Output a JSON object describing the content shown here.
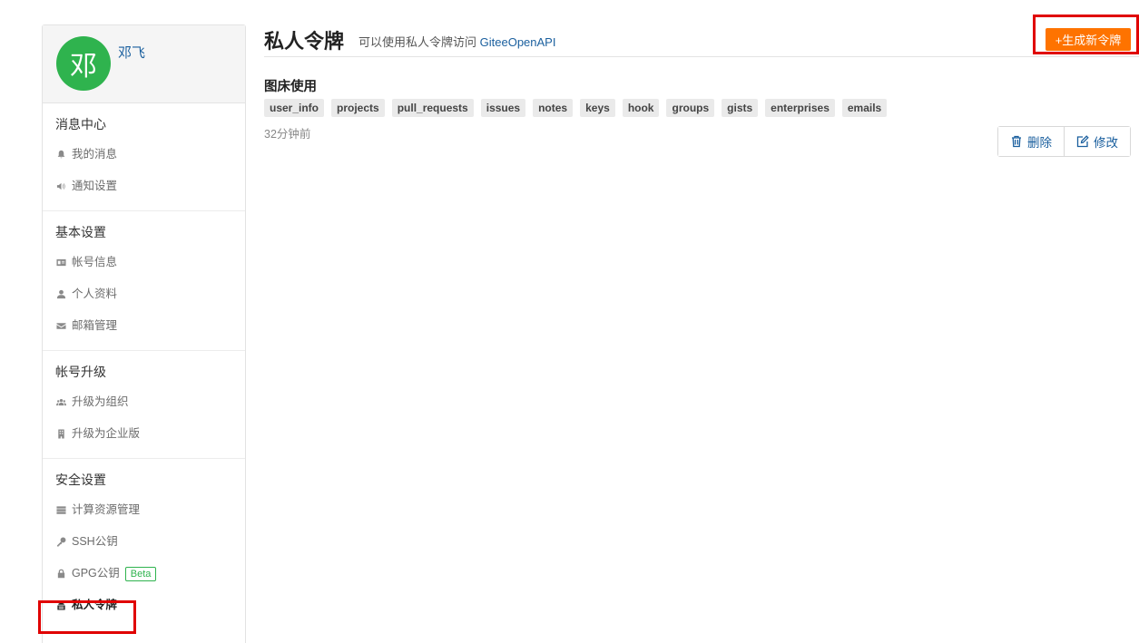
{
  "profile": {
    "avatar_text": "邓",
    "name": "邓飞",
    "avatar_color": "#2fb34e"
  },
  "sidebar": {
    "sections": [
      {
        "title": "消息中心",
        "items": [
          {
            "label": "我的消息",
            "icon": "bell-icon"
          },
          {
            "label": "通知设置",
            "icon": "speaker-icon"
          }
        ]
      },
      {
        "title": "基本设置",
        "items": [
          {
            "label": "帐号信息",
            "icon": "id-card-icon"
          },
          {
            "label": "个人资料",
            "icon": "user-icon"
          },
          {
            "label": "邮箱管理",
            "icon": "envelope-icon"
          }
        ]
      },
      {
        "title": "帐号升级",
        "items": [
          {
            "label": "升级为组织",
            "icon": "users-icon"
          },
          {
            "label": "升级为企业版",
            "icon": "building-icon"
          }
        ]
      },
      {
        "title": "安全设置",
        "items": [
          {
            "label": "计算资源管理",
            "icon": "server-icon"
          },
          {
            "label": "SSH公钥",
            "icon": "key-icon"
          },
          {
            "label": "GPG公钥",
            "icon": "lock-icon",
            "badge": "Beta"
          },
          {
            "label": "私人令牌",
            "icon": "token-icon",
            "active": true
          }
        ]
      }
    ]
  },
  "header": {
    "title": "私人令牌",
    "subtitle_prefix": "可以使用私人令牌访问",
    "subtitle_link": "GiteeOpenAPI",
    "new_button": "+生成新令牌"
  },
  "token": {
    "name": "图床使用",
    "scopes": [
      "user_info",
      "projects",
      "pull_requests",
      "issues",
      "notes",
      "keys",
      "hook",
      "groups",
      "gists",
      "enterprises",
      "emails"
    ],
    "time": "32分钟前",
    "delete_label": "删除",
    "edit_label": "修改"
  },
  "colors": {
    "accent": "#fe7300",
    "link": "#1a5f9e",
    "highlight": "#e00000"
  }
}
